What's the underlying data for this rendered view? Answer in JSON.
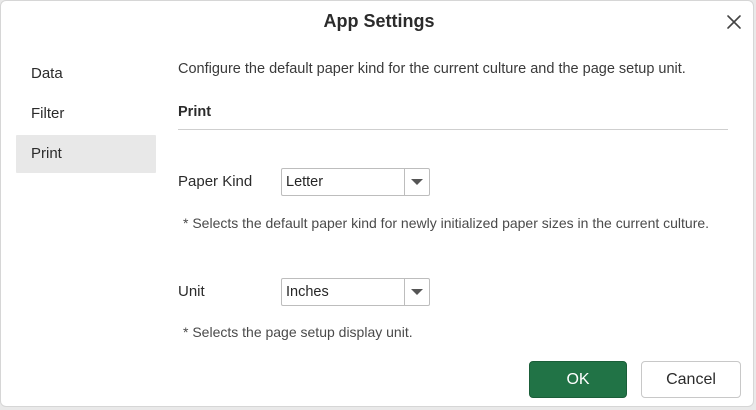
{
  "dialog": {
    "title": "App Settings",
    "close_icon": "close-icon"
  },
  "sidebar": {
    "items": [
      {
        "label": "Data",
        "selected": false
      },
      {
        "label": "Filter",
        "selected": false
      },
      {
        "label": "Print",
        "selected": true
      }
    ]
  },
  "content": {
    "description": "Configure the default paper kind for the current culture and the page setup unit.",
    "section_title": "Print",
    "paper_kind": {
      "label": "Paper Kind",
      "value": "Letter",
      "hint": "* Selects the default paper kind for newly initialized paper sizes in the current culture."
    },
    "unit": {
      "label": "Unit",
      "value": "Inches",
      "hint": "* Selects the page setup display unit."
    }
  },
  "buttons": {
    "ok_label": "OK",
    "cancel_label": "Cancel"
  },
  "colors": {
    "primary": "#217346",
    "selected_item_bg": "#e8e8e8"
  }
}
